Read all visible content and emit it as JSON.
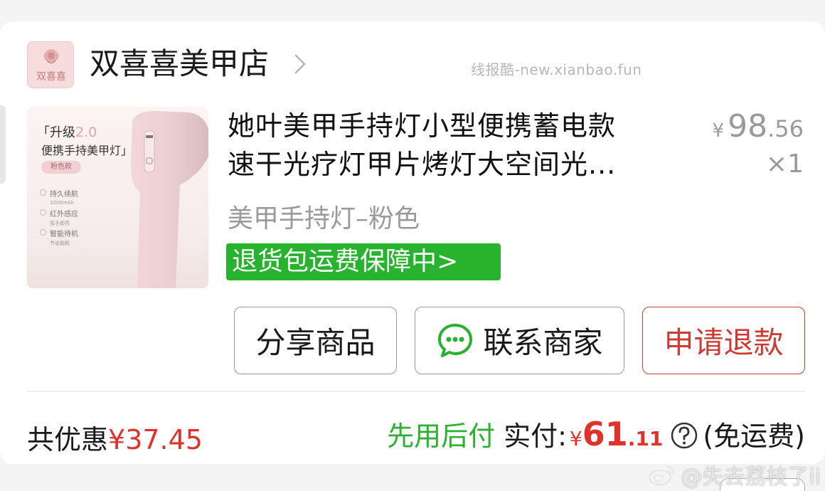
{
  "shop": {
    "logo_text": "双喜喜",
    "name": "双喜喜美甲店"
  },
  "watermark_top": "线报酷-new.xianbao.fun",
  "product": {
    "image": {
      "tag_prefix": "「升级",
      "tag_version": "2.0",
      "subtitle": "便携手持美甲灯」",
      "pill": "粉色款",
      "features": [
        {
          "name": "持久续航",
          "detail": "3200mAh"
        },
        {
          "name": "红外感应",
          "detail": "挥手即亮"
        },
        {
          "name": "智能待机",
          "detail": "节省能耗"
        }
      ]
    },
    "title_line1": "她叶美甲手持灯小型便携蓄电款",
    "title_line2": "速干光疗灯甲片烤灯大空间光...",
    "price_symbol": "¥",
    "price_int": "98",
    "price_dec": ".56",
    "quantity": "×1",
    "sku": "美甲手持灯–粉色",
    "badge": "退货包运费保障中>"
  },
  "actions": {
    "share": "分享商品",
    "contact": "联系商家",
    "refund": "申请退款"
  },
  "summary": {
    "discount_label": "共优惠",
    "discount_amount": "¥37.45",
    "pay_later": "先用后付",
    "paid_label": "实付:",
    "paid_symbol": "¥",
    "paid_int": "61",
    "paid_dec": ".11",
    "shipping": "(免运费)"
  },
  "watermark_bottom": "@失去荔枝了ii",
  "colors": {
    "accent_red": "#e0322a",
    "refund_red": "#cf3a33",
    "badge_green": "#27b32e",
    "pay_green": "#2bb131",
    "muted_gray": "#9a9a9a"
  }
}
